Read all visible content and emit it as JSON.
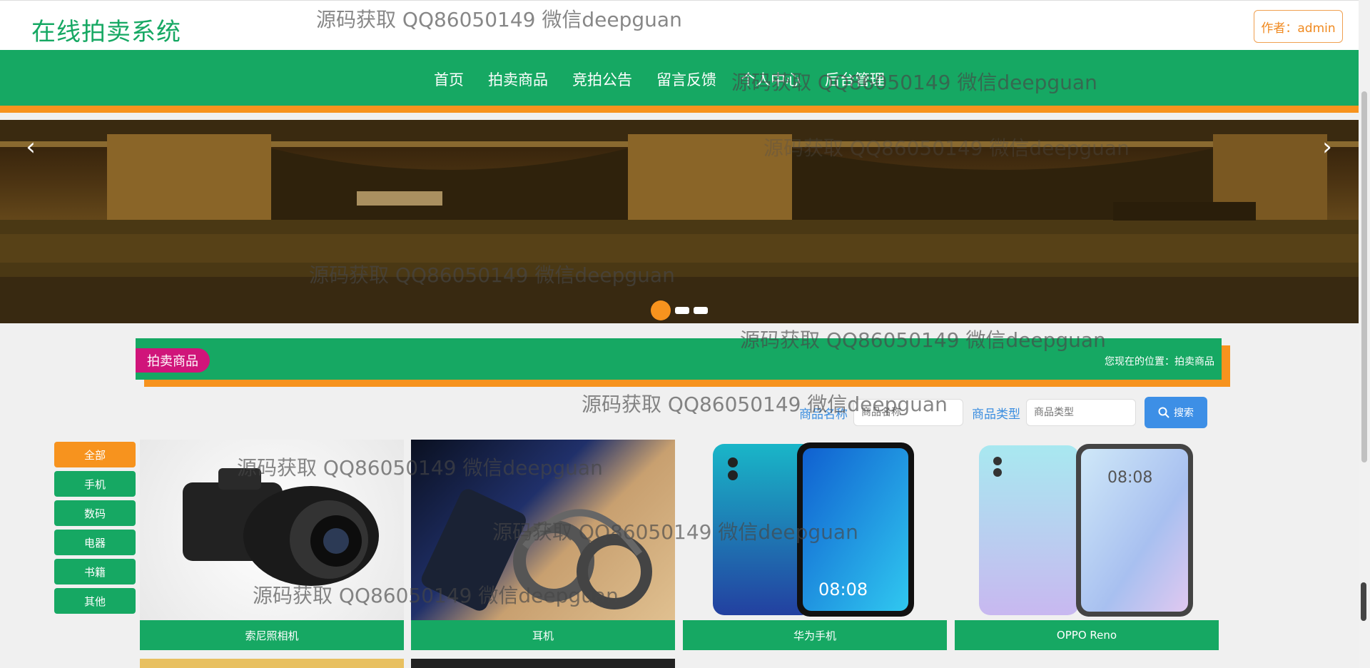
{
  "header": {
    "logo": "在线拍卖系统",
    "author_button": "作者：admin"
  },
  "nav": {
    "items": [
      "首页",
      "拍卖商品",
      "竞拍公告",
      "留言反馈",
      "个人中心",
      "后台管理"
    ]
  },
  "banner": {
    "prev_icon": "chevron-left-icon",
    "next_icon": "chevron-right-icon",
    "slides": 3,
    "active_slide": 1
  },
  "section": {
    "title": "拍卖商品",
    "location": "您现在的位置：拍卖商品"
  },
  "search": {
    "name_label": "商品名称",
    "name_placeholder": "商品名称",
    "type_label": "商品类型",
    "type_placeholder": "商品类型",
    "button": "搜索"
  },
  "categories": {
    "items": [
      "全部",
      "手机",
      "数码",
      "电器",
      "书籍",
      "其他"
    ],
    "active": "全部"
  },
  "products": [
    {
      "name": "索尼照相机"
    },
    {
      "name": "耳机"
    },
    {
      "name": "华为手机"
    },
    {
      "name": "OPPO Reno"
    }
  ],
  "phone_time": "08:08",
  "watermark": "源码获取 QQ86050149 微信deepguan",
  "colors": {
    "green": "#16a863",
    "orange": "#f7931e",
    "pink": "#d0157a",
    "blue": "#3d8fe6"
  }
}
